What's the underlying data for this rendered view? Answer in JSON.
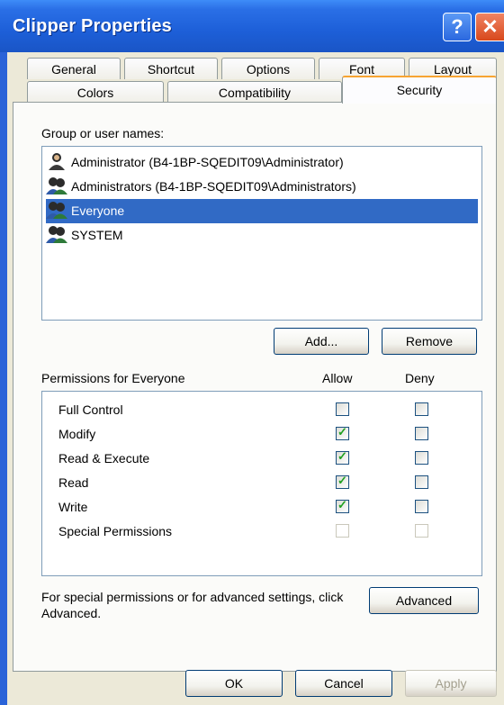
{
  "window": {
    "title": "Clipper Properties"
  },
  "titlebar": {
    "help_glyph": "?",
    "close_glyph": "✕"
  },
  "tabs": {
    "row_top": [
      {
        "label": "General"
      },
      {
        "label": "Shortcut"
      },
      {
        "label": "Options"
      },
      {
        "label": "Font"
      },
      {
        "label": "Layout"
      }
    ],
    "row_bottom": [
      {
        "label": "Colors"
      },
      {
        "label": "Compatibility"
      },
      {
        "label": "Security",
        "active": true
      }
    ]
  },
  "security": {
    "group_label": "Group or user names:",
    "users": [
      {
        "name": "Administrator (B4-1BP-SQEDIT09\\Administrator)",
        "icon": "user-icon"
      },
      {
        "name": "Administrators (B4-1BP-SQEDIT09\\Administrators)",
        "icon": "group-icon"
      },
      {
        "name": "Everyone",
        "icon": "group-icon",
        "selected": true
      },
      {
        "name": "SYSTEM",
        "icon": "group-icon"
      }
    ],
    "add_label": "Add...",
    "remove_label": "Remove",
    "permissions_label": "Permissions for Everyone",
    "allow_header": "Allow",
    "deny_header": "Deny",
    "permissions": [
      {
        "name": "Full Control",
        "allow": false,
        "deny": false
      },
      {
        "name": "Modify",
        "allow": true,
        "deny": false
      },
      {
        "name": "Read & Execute",
        "allow": true,
        "deny": false
      },
      {
        "name": "Read",
        "allow": true,
        "deny": false
      },
      {
        "name": "Write",
        "allow": true,
        "deny": false
      },
      {
        "name": "Special Permissions",
        "allow": false,
        "deny": false,
        "disabled": true
      }
    ],
    "advanced_note": "For special permissions or for advanced settings, click Advanced.",
    "advanced_label": "Advanced"
  },
  "footer": {
    "ok_label": "OK",
    "cancel_label": "Cancel",
    "apply_label": "Apply"
  },
  "colors": {
    "titlebar": "#2a63d8",
    "selection": "#316ac5",
    "tab_accent": "#f7a432",
    "check": "#21a121"
  }
}
